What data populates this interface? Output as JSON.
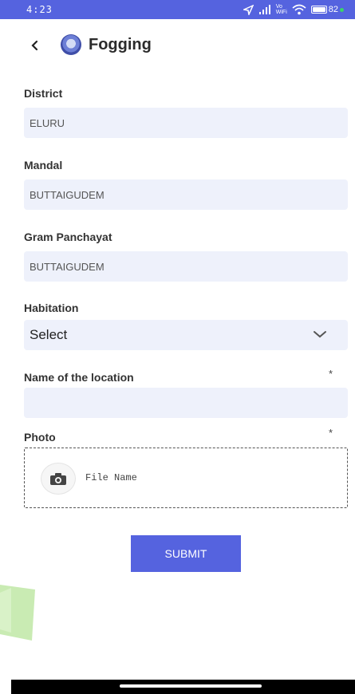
{
  "status_bar": {
    "time": "4:23",
    "network": "Vo\nWiFi",
    "battery": "82"
  },
  "header": {
    "title": "Fogging"
  },
  "form": {
    "district": {
      "label": "District",
      "value": "ELURU"
    },
    "mandal": {
      "label": "Mandal",
      "value": "BUTTAIGUDEM"
    },
    "gram_panchayat": {
      "label": "Gram Panchayat",
      "value": "BUTTAIGUDEM"
    },
    "habitation": {
      "label": "Habitation",
      "selected": "Select"
    },
    "location": {
      "label": "Name of the location",
      "required_mark": "*",
      "value": ""
    },
    "photo": {
      "label": "Photo",
      "required_mark": "*",
      "file_name": "File Name"
    }
  },
  "submit_label": "SUBMIT",
  "colors": {
    "accent": "#5563df",
    "field_bg": "#eef1fb",
    "deco_green": "#bfe8a6"
  }
}
